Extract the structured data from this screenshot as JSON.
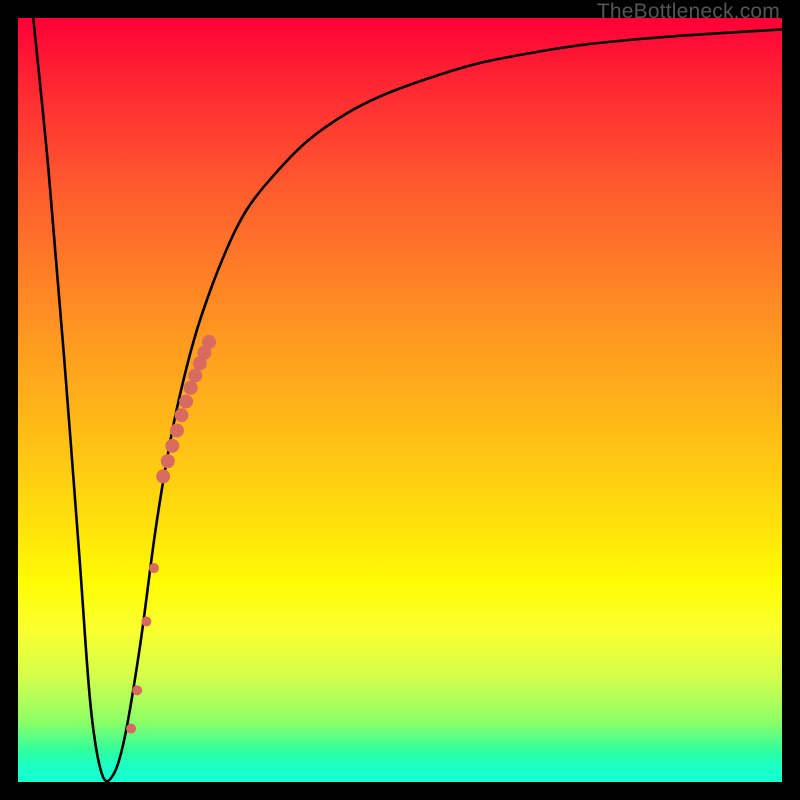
{
  "watermark": "TheBottleneck.com",
  "chart_data": {
    "type": "line",
    "title": "",
    "xlabel": "",
    "ylabel": "",
    "xlim": [
      0,
      100
    ],
    "ylim": [
      0,
      100
    ],
    "curve": {
      "name": "bottleneck-curve",
      "x": [
        2,
        4,
        6,
        8,
        9.5,
        11,
        12.5,
        14,
        16,
        18,
        20,
        22,
        24,
        27,
        30,
        34,
        38,
        43,
        48,
        54,
        60,
        67,
        74,
        82,
        90,
        100
      ],
      "y": [
        100,
        80,
        56,
        30,
        10,
        1,
        1,
        6,
        18,
        33,
        45,
        54,
        61,
        69,
        75,
        80,
        84,
        87.5,
        90,
        92.2,
        94,
        95.4,
        96.5,
        97.3,
        97.9,
        98.5
      ]
    },
    "scatter": {
      "name": "highlight-points",
      "color": "#d86a5f",
      "points": [
        {
          "x": 19.0,
          "y": 40.0,
          "r": 7
        },
        {
          "x": 19.6,
          "y": 42.0,
          "r": 7
        },
        {
          "x": 20.2,
          "y": 44.0,
          "r": 7
        },
        {
          "x": 20.8,
          "y": 46.0,
          "r": 7
        },
        {
          "x": 21.4,
          "y": 48.0,
          "r": 7
        },
        {
          "x": 22.0,
          "y": 49.8,
          "r": 7
        },
        {
          "x": 22.6,
          "y": 51.6,
          "r": 7
        },
        {
          "x": 23.2,
          "y": 53.2,
          "r": 7
        },
        {
          "x": 23.8,
          "y": 54.8,
          "r": 7
        },
        {
          "x": 24.4,
          "y": 56.2,
          "r": 7
        },
        {
          "x": 25.0,
          "y": 57.6,
          "r": 7
        },
        {
          "x": 17.8,
          "y": 28.0,
          "r": 5
        },
        {
          "x": 16.8,
          "y": 21.0,
          "r": 5
        },
        {
          "x": 15.6,
          "y": 12.0,
          "r": 5
        },
        {
          "x": 14.8,
          "y": 7.0,
          "r": 5
        }
      ]
    }
  }
}
